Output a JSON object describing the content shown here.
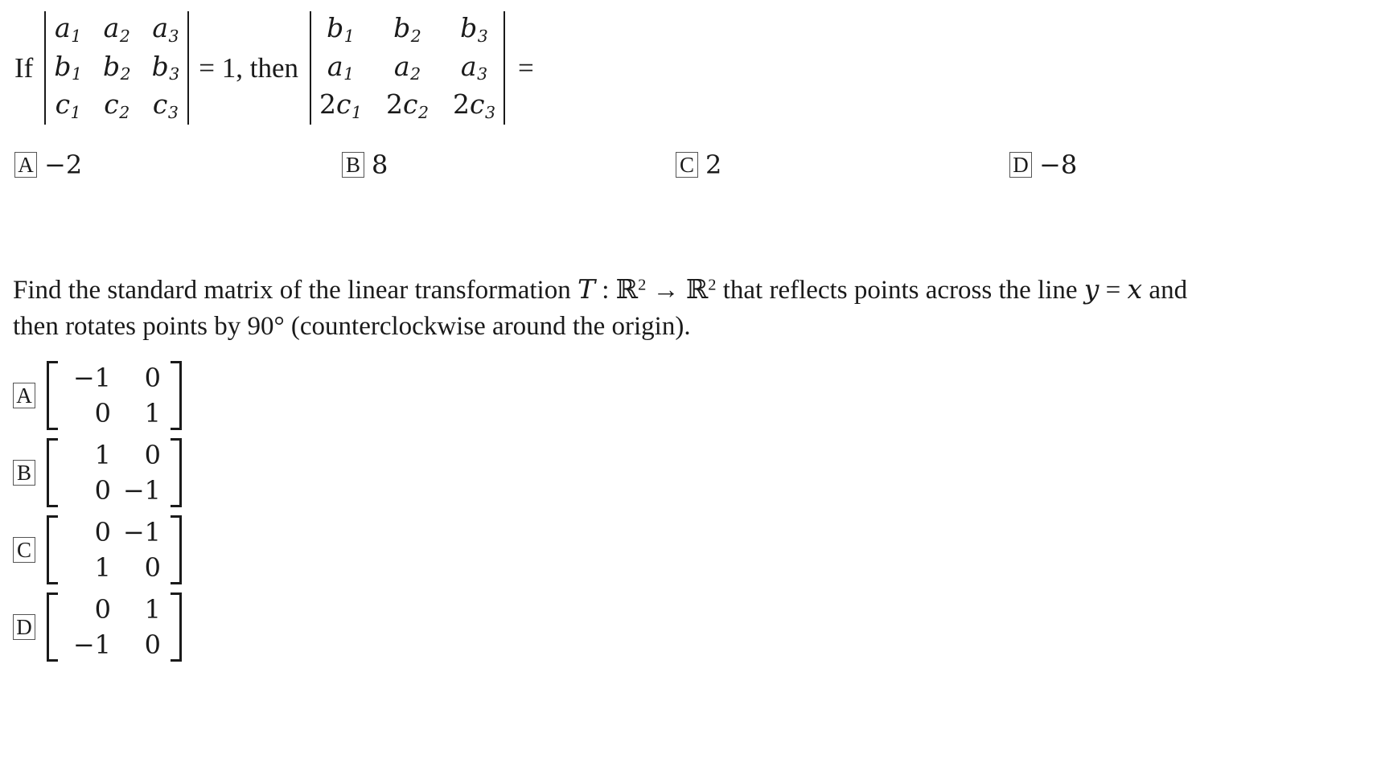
{
  "question1": {
    "lead": "If",
    "connector": "= 1, then",
    "tail": "=",
    "matrix_left": {
      "rows": [
        [
          "a1",
          "a2",
          "a3"
        ],
        [
          "b1",
          "b2",
          "b3"
        ],
        [
          "c1",
          "c2",
          "c3"
        ]
      ]
    },
    "matrix_right": {
      "rows": [
        [
          "b1",
          "b2",
          "b3"
        ],
        [
          "a1",
          "a2",
          "a3"
        ],
        [
          "2c1",
          "2c2",
          "2c3"
        ]
      ]
    },
    "choices": [
      {
        "letter": "A",
        "value": "−2"
      },
      {
        "letter": "B",
        "value": "8"
      },
      {
        "letter": "C",
        "value": "2"
      },
      {
        "letter": "D",
        "value": "−8"
      }
    ]
  },
  "question2": {
    "text_part1": "Find the standard matrix of the linear transformation ",
    "transform_symbol": "T",
    "colon": " : ",
    "domain": "ℝ",
    "domain_exp": "2",
    "arrow": " → ",
    "codomain": "ℝ",
    "codomain_exp": "2",
    "text_part2": " that reflects points across the line ",
    "line_y": "y",
    "line_eq": " = ",
    "line_x": "x",
    "text_part3": " and then rotates points by 90° (counterclockwise around the origin).",
    "choices": [
      {
        "letter": "A",
        "rows": [
          [
            "−1",
            "0"
          ],
          [
            "0",
            "1"
          ]
        ]
      },
      {
        "letter": "B",
        "rows": [
          [
            "1",
            "0"
          ],
          [
            "0",
            "−1"
          ]
        ]
      },
      {
        "letter": "C",
        "rows": [
          [
            "0",
            "−1"
          ],
          [
            "1",
            "0"
          ]
        ]
      },
      {
        "letter": "D",
        "rows": [
          [
            "0",
            "1"
          ],
          [
            "−1",
            "0"
          ]
        ]
      }
    ]
  }
}
